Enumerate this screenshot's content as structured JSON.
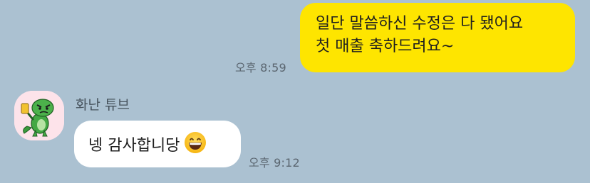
{
  "outgoing": {
    "lines": [
      "일단 말씀하신 수정은 다 됐어요",
      "첫 매출 축하드려요~"
    ],
    "time": "오후 8:59",
    "bubble_color": "#fee500"
  },
  "incoming": {
    "sender": "화난 튜브",
    "text": "넹 감사합니당",
    "emoji": "grinning-face-emoji",
    "time": "오후 9:12",
    "bubble_color": "#ffffff"
  },
  "colors": {
    "background": "#abc1d1",
    "timestamp": "#5b6670"
  }
}
